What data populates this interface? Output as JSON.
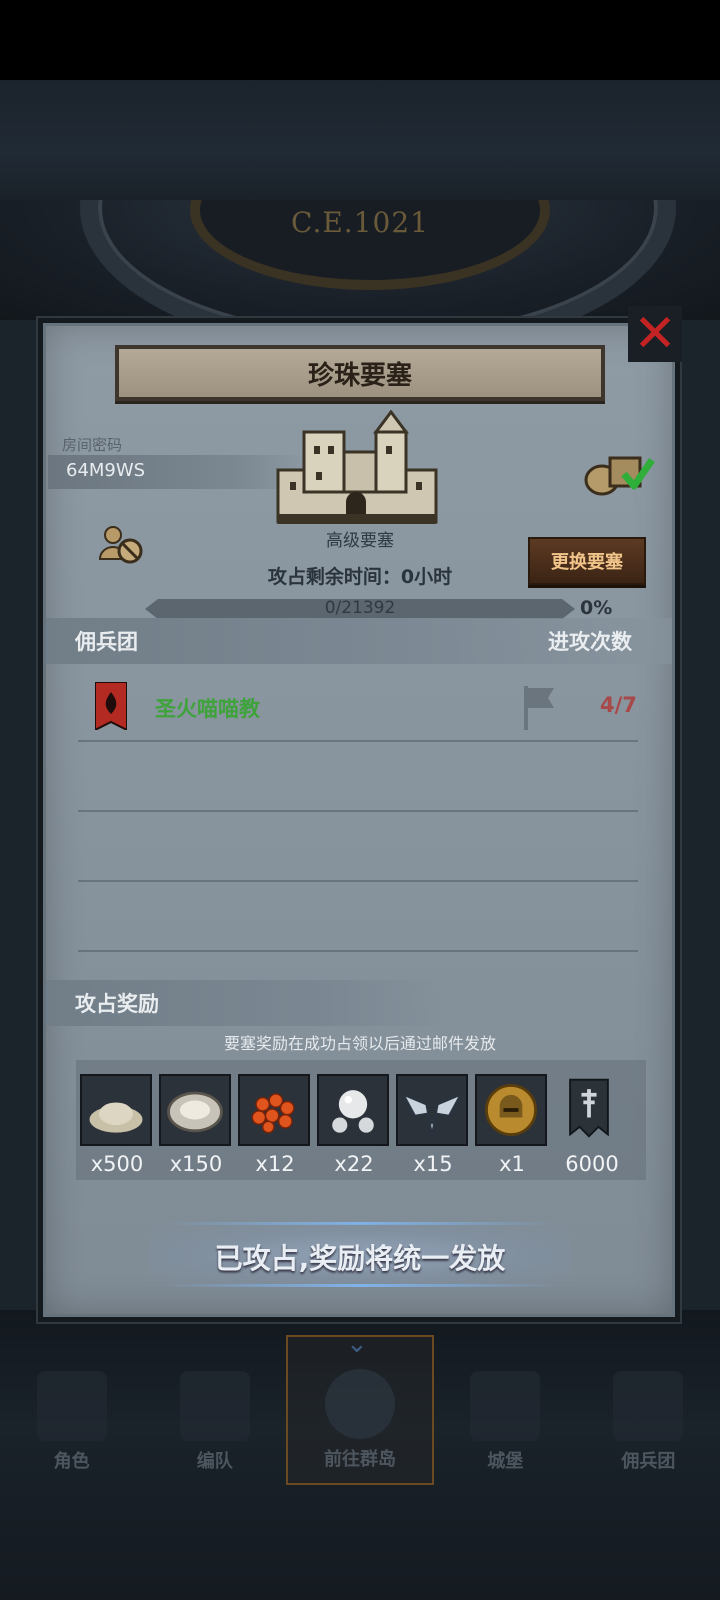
{
  "background": {
    "era_label": "C.E.1021"
  },
  "modal": {
    "title": "珍珠要塞",
    "room": {
      "label": "房间密码",
      "code": "64M9WS"
    },
    "fortress": {
      "name": "高级要塞",
      "time_left": "攻占剩余时间：0小时"
    },
    "change_button": "更换要塞",
    "progress": {
      "text": "0/21392",
      "percent_label": "0%",
      "fraction": 0.0
    },
    "mercenary": {
      "header_left": "佣兵团",
      "header_right": "进攻次数",
      "rows": [
        {
          "name": "圣火喵喵教",
          "attacks": "4/7"
        }
      ]
    },
    "rewards": {
      "title": "攻占奖励",
      "note": "要塞奖励在成功占领以后通过邮件发放",
      "items": [
        {
          "icon": "powder-icon",
          "qty": "x500"
        },
        {
          "icon": "oyster-icon",
          "qty": "x150"
        },
        {
          "icon": "roe-icon",
          "qty": "x12"
        },
        {
          "icon": "pearl-icon",
          "qty": "x22"
        },
        {
          "icon": "winged-emblem-icon",
          "qty": "x15"
        },
        {
          "icon": "gold-helmet-coin-icon",
          "qty": "x1"
        },
        {
          "icon": "guild-banner-icon",
          "qty": "6000"
        }
      ]
    },
    "claim_status": "已攻占,奖励将统一发放"
  },
  "nav": {
    "items": [
      {
        "label": "角色"
      },
      {
        "label": "编队"
      },
      {
        "label": "前往群岛",
        "active": true
      },
      {
        "label": "城堡"
      },
      {
        "label": "佣兵团"
      }
    ]
  },
  "colors": {
    "accent_green": "#3ea33a",
    "attack_red": "#a94848",
    "close_red": "#c42323"
  }
}
